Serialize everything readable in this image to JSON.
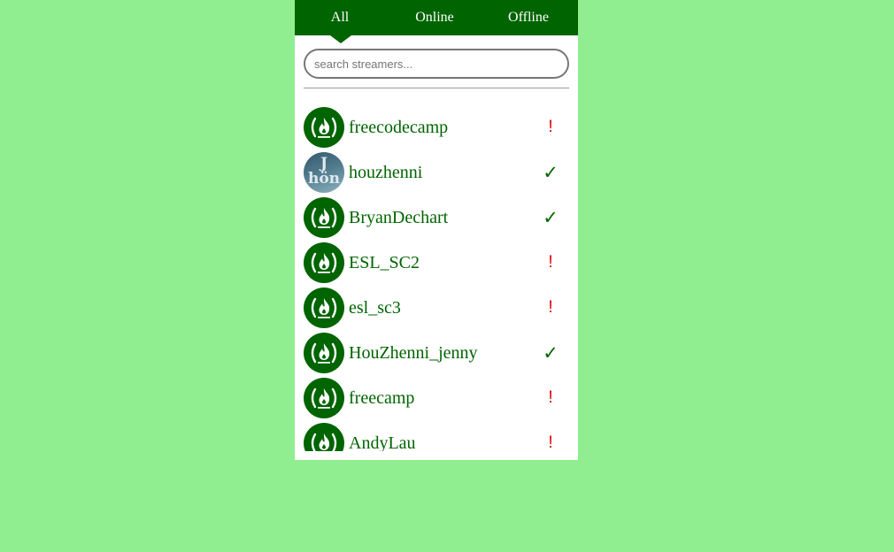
{
  "tabs": [
    {
      "label": "All",
      "active": true
    },
    {
      "label": "Online",
      "active": false
    },
    {
      "label": "Offline",
      "active": false
    }
  ],
  "search": {
    "placeholder": "search streamers...",
    "value": ""
  },
  "colors": {
    "page_background": "#90ee90",
    "accent": "#006400",
    "offline_status": "#e00000",
    "panel_background": "#ffffff"
  },
  "icons": {
    "online": "checkmark-icon",
    "offline": "exclamation-icon",
    "default_avatar": "freecodecamp-logo"
  },
  "status_glyphs": {
    "online": "✓",
    "offline": "!"
  },
  "streamers": [
    {
      "name": "freecodecamp",
      "status": "offline",
      "avatar": "freecodecamp-logo"
    },
    {
      "name": "houzhenni",
      "status": "online",
      "avatar": "photo",
      "avatar_text": "J hön"
    },
    {
      "name": "BryanDechart",
      "status": "online",
      "avatar": "freecodecamp-logo"
    },
    {
      "name": "ESL_SC2",
      "status": "offline",
      "avatar": "freecodecamp-logo"
    },
    {
      "name": "esl_sc3",
      "status": "offline",
      "avatar": "freecodecamp-logo"
    },
    {
      "name": "HouZhenni_jenny",
      "status": "online",
      "avatar": "freecodecamp-logo"
    },
    {
      "name": "freecamp",
      "status": "offline",
      "avatar": "freecodecamp-logo"
    },
    {
      "name": "AndyLau",
      "status": "offline",
      "avatar": "freecodecamp-logo"
    }
  ]
}
